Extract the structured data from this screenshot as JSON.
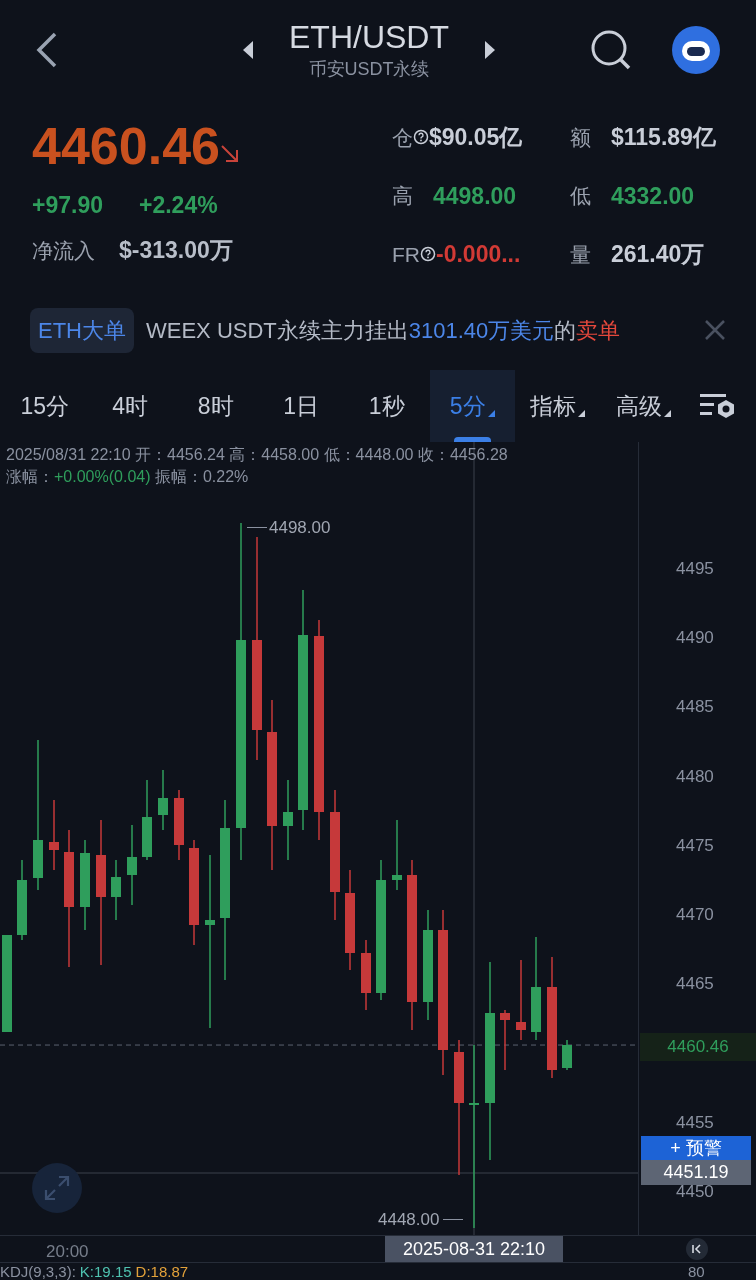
{
  "header": {
    "title": "ETH/USDT",
    "subtitle": "币安USDT永续"
  },
  "price": {
    "last": "4460.46",
    "falling": true,
    "change": "+97.90",
    "change_pct": "+2.24%",
    "net_inflow_label": "净流入",
    "net_inflow": "$-313.00万"
  },
  "stats": [
    {
      "label": "仓",
      "help": true,
      "value": "$90.05亿",
      "color": "#c9ced8"
    },
    {
      "label": "额",
      "help": false,
      "value": "$115.89亿",
      "color": "#c9ced8"
    },
    {
      "label": "高",
      "help": false,
      "value": "4498.00",
      "color": "#2f9e5c"
    },
    {
      "label": "低",
      "help": false,
      "value": "4332.00",
      "color": "#2f9e5c"
    },
    {
      "label": "FR",
      "help": true,
      "value": "-0.000...",
      "color": "#d23a35"
    },
    {
      "label": "量",
      "help": false,
      "value": "261.40万",
      "color": "#c9ced8"
    }
  ],
  "banner": {
    "tag": "ETH大单",
    "message": [
      {
        "text": "WEEX USDT永续主力挂出",
        "color": "#b4bac6"
      },
      {
        "text": "3101.40万美元",
        "color": "#4c86e8"
      },
      {
        "text": "的",
        "color": "#b4bac6"
      },
      {
        "text": "卖单",
        "color": "#e5483c"
      }
    ]
  },
  "intervals": [
    {
      "label": "15分",
      "selected": false,
      "dropdown": false
    },
    {
      "label": "4时",
      "selected": false,
      "dropdown": false
    },
    {
      "label": "8时",
      "selected": false,
      "dropdown": false
    },
    {
      "label": "1日",
      "selected": false,
      "dropdown": false
    },
    {
      "label": "1秒",
      "selected": false,
      "dropdown": false
    },
    {
      "label": "5分",
      "selected": true,
      "dropdown": true
    },
    {
      "label": "指标",
      "selected": false,
      "dropdown": true
    },
    {
      "label": "高级",
      "selected": false,
      "dropdown": true
    }
  ],
  "candle_info": {
    "time": "2025/08/31 22:10",
    "ohlc": [
      {
        "label": "开：",
        "value": "4456.24"
      },
      {
        "label": "高：",
        "value": "4458.00"
      },
      {
        "label": "低：",
        "value": "4448.00"
      },
      {
        "label": "收：",
        "value": "4456.28"
      }
    ],
    "change_label": "涨幅：",
    "change": "+0.00%(0.04)",
    "amplitude_label": "振幅：",
    "amplitude": "0.22%"
  },
  "chart": {
    "high_marker": "4498.00",
    "low_marker": "4448.00",
    "y_labels": [
      "4495",
      "4490",
      "4485",
      "4480",
      "4475",
      "4470",
      "4465",
      "4455",
      "4450"
    ],
    "last_price": "4460.46",
    "alert_button": "+ 预警",
    "crosshair_price": "4451.19",
    "time_label": "20:00",
    "crosshair_time": "2025-08-31 22:10"
  },
  "indicator": {
    "name": "KDJ(9,3,3):",
    "values": [
      {
        "text": "K:19.15",
        "color": "#4fc3b0"
      },
      {
        "text": "D:18.87",
        "color": "#e3a23a"
      }
    ],
    "axis_label": "80"
  }
}
